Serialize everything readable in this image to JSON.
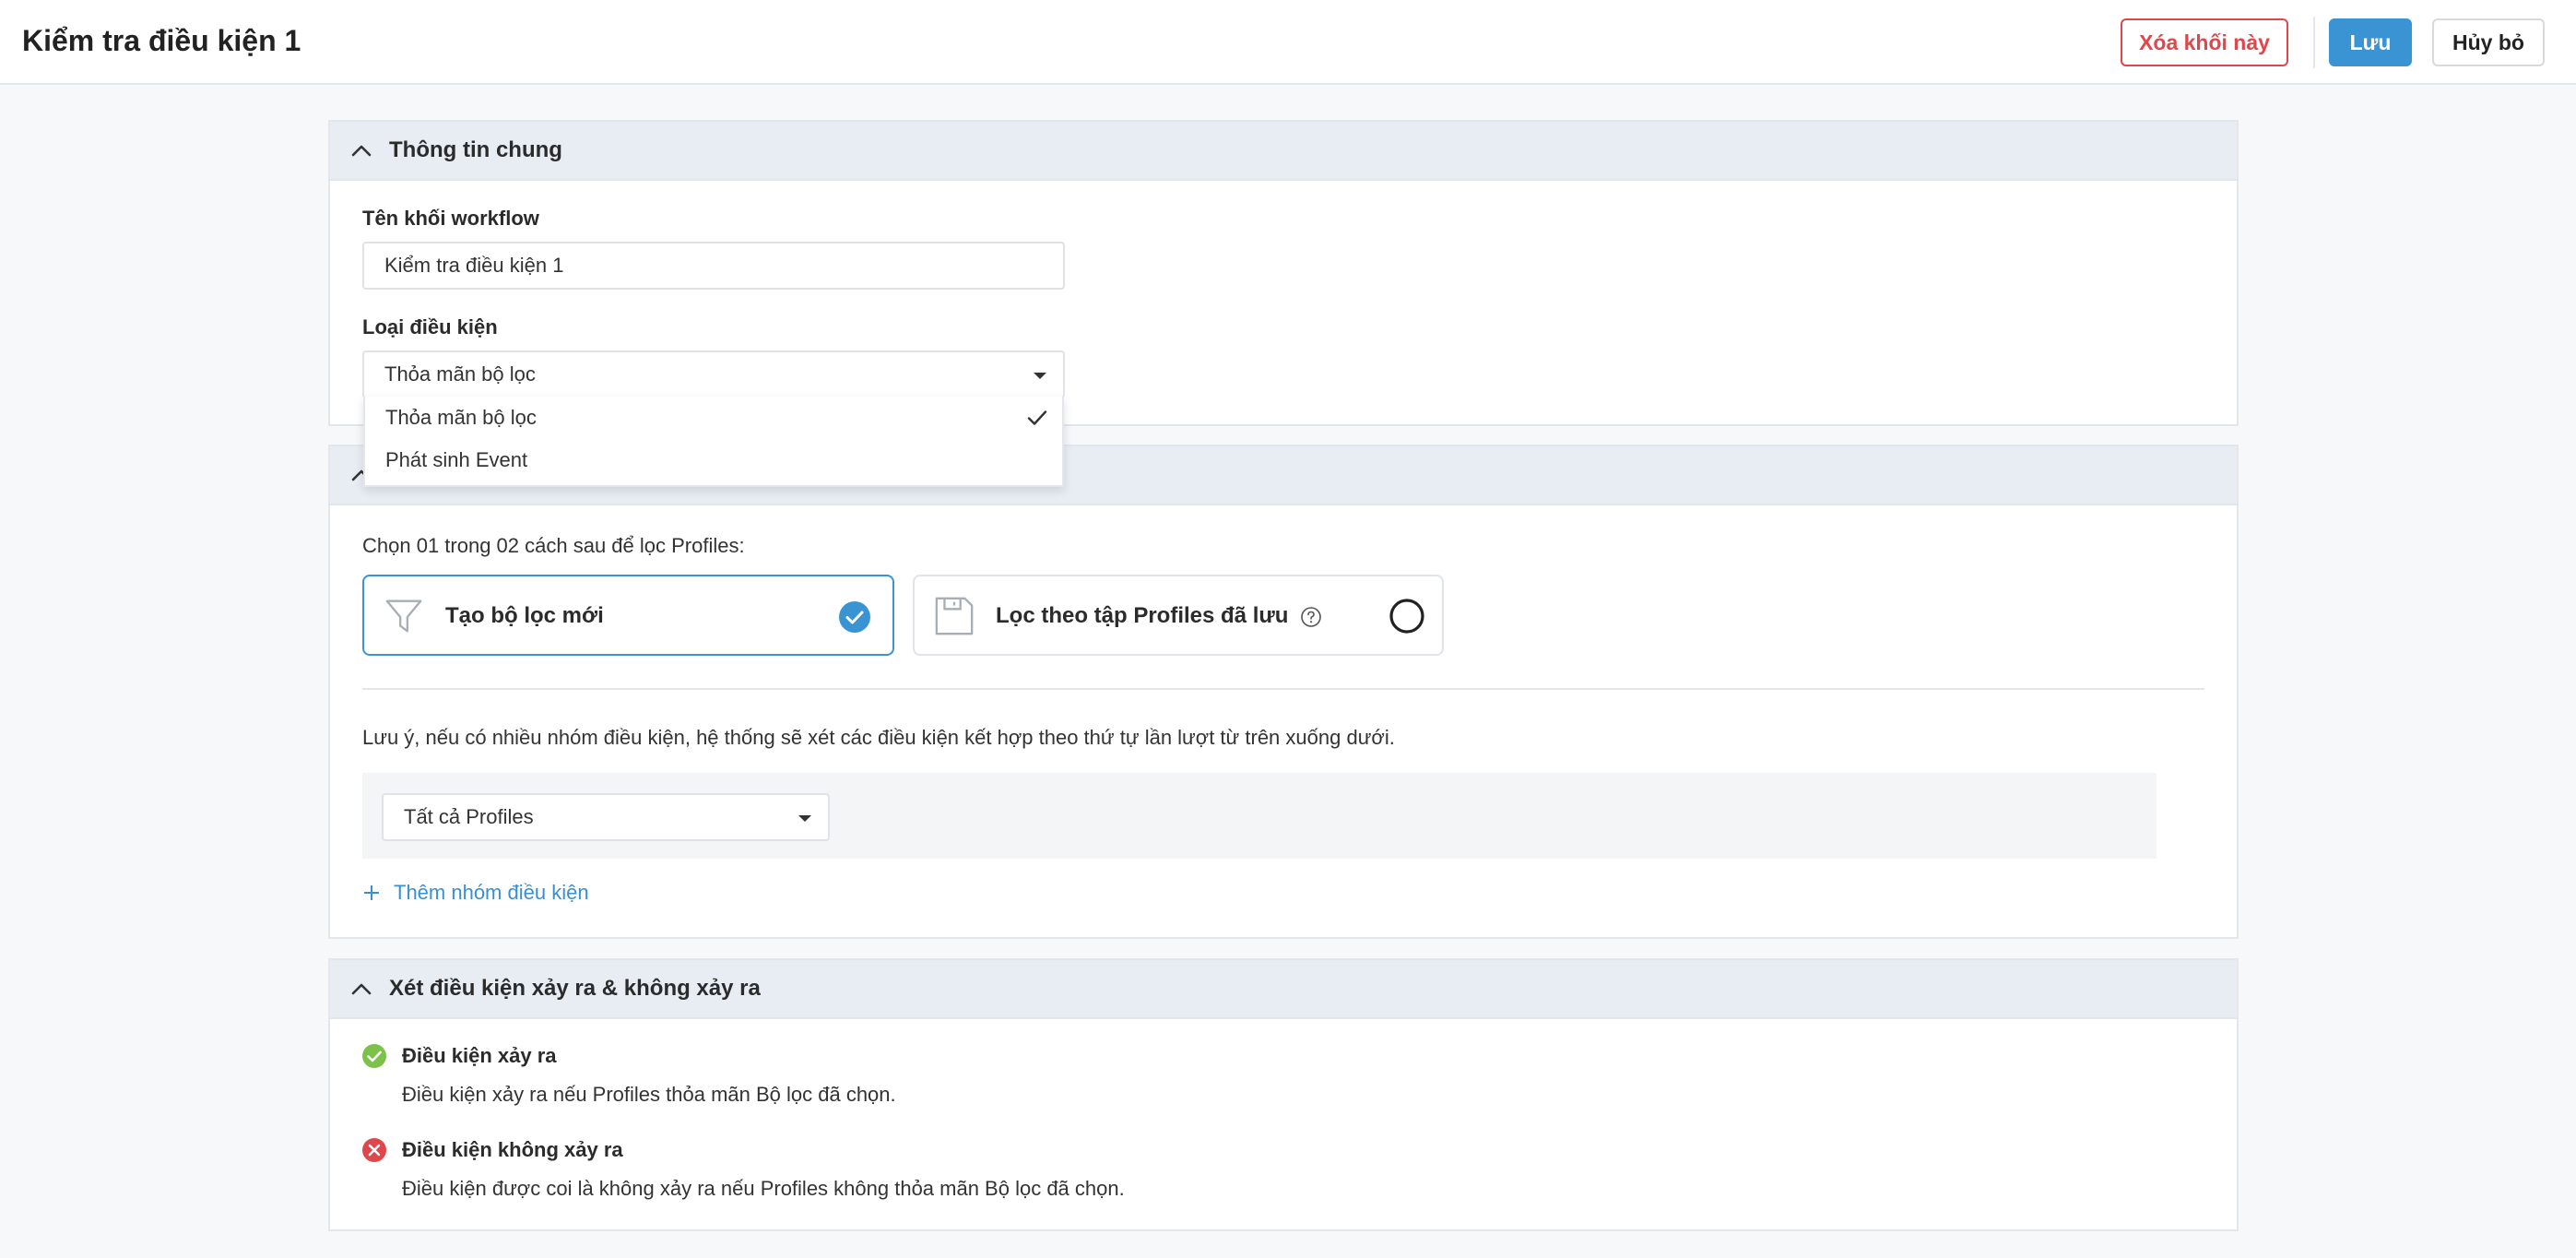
{
  "header": {
    "title": "Kiểm tra điều kiện 1",
    "delete_label": "Xóa khối này",
    "save_label": "Lưu",
    "cancel_label": "Hủy bỏ"
  },
  "general": {
    "section_title": "Thông tin chung",
    "name_label": "Tên khối workflow",
    "name_value": "Kiểm tra điều kiện 1",
    "condition_type_label": "Loại điều kiện",
    "condition_type_value": "Thỏa mãn bộ lọc",
    "condition_type_options": [
      "Thỏa mãn bộ lọc",
      "Phát sinh Event"
    ]
  },
  "filter": {
    "intro": "Chọn 01 trong 02 cách sau để lọc Profiles:",
    "option_new": "Tạo bộ lọc mới",
    "option_saved": "Lọc theo tập Profiles đã lưu",
    "note": "Lưu ý, nếu có nhiều nhóm điều kiện, hệ thống sẽ xét các điều kiện kết hợp theo thứ tự lần lượt từ trên xuống dưới.",
    "group_select_value": "Tất cả Profiles",
    "add_group_label": "Thêm nhóm điều kiện"
  },
  "outcome": {
    "section_title": "Xét điều kiện xảy ra & không xảy ra",
    "yes_title": "Điều kiện xảy ra",
    "yes_desc": "Điều kiện xảy ra nếu Profiles thỏa mãn Bộ lọc đã chọn.",
    "no_title": "Điều kiện không xảy ra",
    "no_desc": "Điều kiện được coi là không xảy ra nếu Profiles không thỏa mãn Bộ lọc đã chọn."
  },
  "colors": {
    "primary": "#3a94d4",
    "danger": "#e0474c",
    "success": "#7cc24a",
    "section_header_bg": "#e7edf3"
  }
}
